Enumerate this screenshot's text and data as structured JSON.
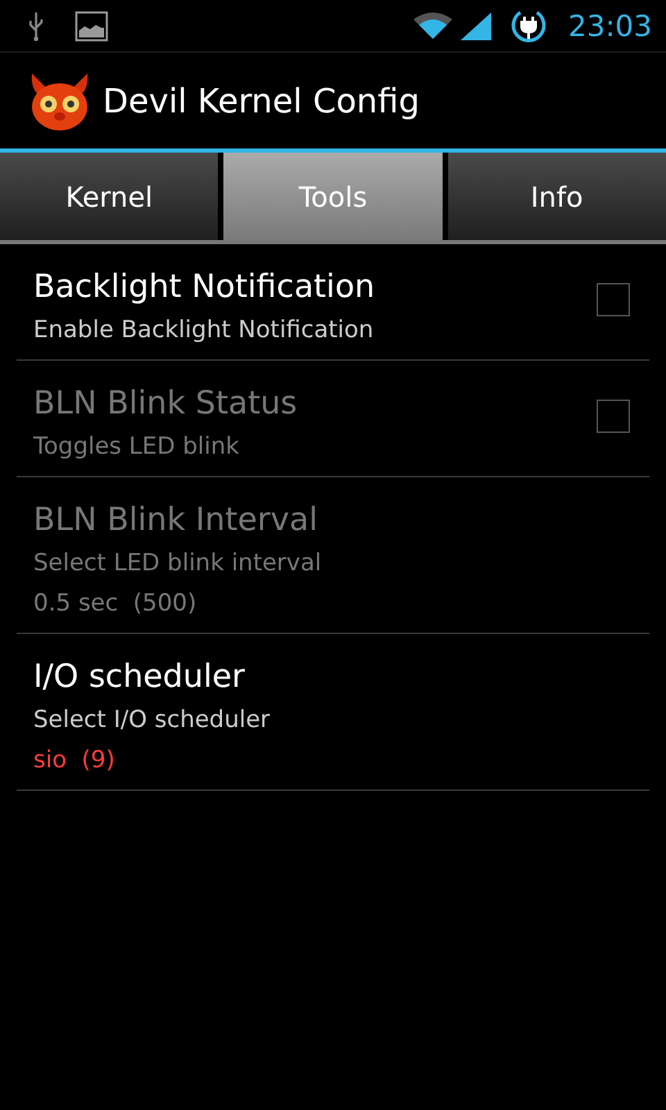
{
  "status_bar": {
    "time": "23:03"
  },
  "app_bar": {
    "title": "Devil Kernel Config"
  },
  "tabs": [
    {
      "label": "Kernel",
      "selected": false
    },
    {
      "label": "Tools",
      "selected": true
    },
    {
      "label": "Info",
      "selected": false
    }
  ],
  "preferences": [
    {
      "kind": "checkbox",
      "title": "Backlight Notification",
      "summary": "Enable Backlight Notification",
      "checked": false,
      "disabled": false
    },
    {
      "kind": "checkbox",
      "title": "BLN Blink Status",
      "summary": "Toggles LED blink",
      "checked": false,
      "disabled": true
    },
    {
      "kind": "list",
      "title": "BLN Blink Interval",
      "summary": "Select LED blink interval",
      "value": "0.5 sec  (500)",
      "disabled": true
    },
    {
      "kind": "list",
      "title": "I/O scheduler",
      "summary": "Select I/O scheduler",
      "value": "sio  (9)",
      "disabled": false
    }
  ]
}
